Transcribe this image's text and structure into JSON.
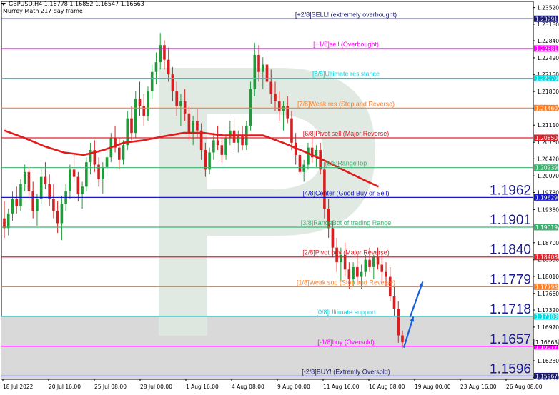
{
  "header": {
    "symbol_line": "GBPUSD,H4  1.16778 1.16852 1.16547 1.16663",
    "indicator_line": "Murrey Math 217 day frame"
  },
  "colors": {
    "background": "#ffffff",
    "bull_candle": "#1f9c3a",
    "bear_candle": "#d42020",
    "ma_line": "#e01b1b",
    "shaded_zone": "#d9d9d9",
    "arrow": "#1560e0",
    "axis_text": "#000000",
    "watermark": "#dde8df"
  },
  "chart_data": {
    "type": "candlestick",
    "title": "GBPUSD,H4",
    "ylim": [
      1.159,
      1.235
    ],
    "y_ticks": [
      "1.23520",
      "1.23180",
      "1.22840",
      "1.22490",
      "1.22150",
      "1.21800",
      "1.21450",
      "1.21110",
      "1.20760",
      "1.20420",
      "1.20070",
      "1.19730",
      "1.19380",
      "1.19040",
      "1.18700",
      "1.18350",
      "1.18010",
      "1.17660",
      "1.17320",
      "1.16970",
      "1.16630",
      "1.16280",
      "1.15940"
    ],
    "x_ticks": [
      "18 Jul 2022",
      "20 Jul 16:00",
      "25 Jul 08:00",
      "28 Jul 00:00",
      "1 Aug 16:00",
      "4 Aug 08:00",
      "9 Aug 00:00",
      "11 Aug 16:00",
      "16 Aug 08:00",
      "19 Aug 00:00",
      "23 Aug 16:00",
      "26 Aug 08:00"
    ],
    "murrey_levels": [
      {
        "label": "[+2/8]SELL! (extremely overbought)",
        "price": 1.23291,
        "tag": "1.23291",
        "color": "#1a1a6e"
      },
      {
        "label": "[+1/8]sell (Overbought)",
        "price": 1.22681,
        "tag": "1.22681",
        "color": "#ff00ff"
      },
      {
        "label": "[8/8]Ultimate resistance",
        "price": 1.2207,
        "tag": "1.22070",
        "color": "#00d8e0"
      },
      {
        "label": "[7/8]Weak res (Stop and Reverse)",
        "price": 1.2146,
        "tag": "1.21460",
        "color": "#ff7f27"
      },
      {
        "label": "[6/8]Pivot sell (Major Reverse)",
        "price": 1.2085,
        "tag": "1.20850",
        "color": "#e0202a"
      },
      {
        "label": "[5/8]RangeTop",
        "price": 1.20239,
        "tag": "1.20239",
        "color": "#3cb371"
      },
      {
        "label": "[4/8]Center (Good Buy or Sell)",
        "price": 1.19629,
        "tag": "1.19629",
        "color": "#1818c8"
      },
      {
        "label": "[3/8]RangeBot of trading Range",
        "price": 1.19019,
        "tag": "1.19019",
        "color": "#3cb371"
      },
      {
        "label": "[2/8]Pivot buy (Major Reverse)",
        "price": 1.18408,
        "tag": "1.18408",
        "color": "#e0202a"
      },
      {
        "label": "[1/8]Weak sup (Stop and Reverse)",
        "price": 1.17798,
        "tag": "1.17798",
        "color": "#ff7f27"
      },
      {
        "label": "[0/8]Ultimate support",
        "price": 1.17188,
        "tag": "1.17188",
        "color": "#00d8e0"
      },
      {
        "label": "[-1/8]buy (Oversold)",
        "price": 1.16577,
        "tag": "1.16577",
        "color": "#ff00ff"
      },
      {
        "label": "[-2/8]BUY! (Extremly Oversold)",
        "price": 1.15967,
        "tag": "1.15967",
        "color": "#1a1a6e"
      }
    ],
    "current_price_tag": "1.16663",
    "big_labels": [
      {
        "text": "1.1962",
        "price": 1.19629
      },
      {
        "text": "1.1901",
        "price": 1.19019
      },
      {
        "text": "1.1840",
        "price": 1.18408
      },
      {
        "text": "1.1779",
        "price": 1.17798
      },
      {
        "text": "1.1718",
        "price": 1.17188
      },
      {
        "text": "1.1657",
        "price": 1.16577
      },
      {
        "text": "1.1596",
        "price": 1.15967
      }
    ],
    "candles": [
      [
        1.192,
        1.1955,
        1.188,
        1.19
      ],
      [
        1.19,
        1.194,
        1.1885,
        1.193
      ],
      [
        1.193,
        1.1975,
        1.1915,
        1.196
      ],
      [
        1.196,
        1.1985,
        1.193,
        1.1945
      ],
      [
        1.1945,
        1.2,
        1.1935,
        1.199
      ],
      [
        1.199,
        1.203,
        1.1975,
        1.2015
      ],
      [
        1.2015,
        1.2025,
        1.196,
        1.1975
      ],
      [
        1.1975,
        1.1995,
        1.192,
        1.1935
      ],
      [
        1.1935,
        1.197,
        1.1905,
        1.196
      ],
      [
        1.196,
        1.202,
        1.195,
        1.2005
      ],
      [
        1.2005,
        1.2035,
        1.198,
        1.199
      ],
      [
        1.199,
        1.201,
        1.1945,
        1.196
      ],
      [
        1.196,
        1.199,
        1.192,
        1.1935
      ],
      [
        1.1935,
        1.1955,
        1.189,
        1.191
      ],
      [
        1.191,
        1.1965,
        1.1875,
        1.195
      ],
      [
        1.195,
        1.199,
        1.1935,
        1.1975
      ],
      [
        1.1975,
        1.203,
        1.196,
        1.202
      ],
      [
        1.202,
        1.205,
        1.1995,
        1.2005
      ],
      [
        1.2005,
        1.2015,
        1.1955,
        1.197
      ],
      [
        1.197,
        1.1995,
        1.194,
        1.1985
      ],
      [
        1.1985,
        1.2045,
        1.1975,
        1.2035
      ],
      [
        1.2035,
        1.2075,
        1.201,
        1.206
      ],
      [
        1.206,
        1.208,
        1.2015,
        1.203
      ],
      [
        1.203,
        1.2045,
        1.1985,
        1.2
      ],
      [
        1.2,
        1.2035,
        1.197,
        1.2025
      ],
      [
        1.2025,
        1.206,
        1.2005,
        1.2045
      ],
      [
        1.2045,
        1.2095,
        1.2035,
        1.2085
      ],
      [
        1.2085,
        1.211,
        1.2055,
        1.2065
      ],
      [
        1.2065,
        1.2085,
        1.202,
        1.204
      ],
      [
        1.204,
        1.208,
        1.203,
        1.207
      ],
      [
        1.207,
        1.214,
        1.206,
        1.2125
      ],
      [
        1.2125,
        1.215,
        1.208,
        1.2095
      ],
      [
        1.2095,
        1.218,
        1.2085,
        1.2165
      ],
      [
        1.2165,
        1.22,
        1.213,
        1.215
      ],
      [
        1.215,
        1.2175,
        1.211,
        1.213
      ],
      [
        1.213,
        1.219,
        1.212,
        1.218
      ],
      [
        1.218,
        1.2235,
        1.2165,
        1.222
      ],
      [
        1.222,
        1.226,
        1.2195,
        1.224
      ],
      [
        1.224,
        1.23,
        1.2225,
        1.2275
      ],
      [
        1.2275,
        1.2285,
        1.2225,
        1.2245
      ],
      [
        1.2245,
        1.227,
        1.22,
        1.2215
      ],
      [
        1.2215,
        1.223,
        1.216,
        1.218
      ],
      [
        1.218,
        1.22,
        1.213,
        1.215
      ],
      [
        1.215,
        1.2175,
        1.211,
        1.216
      ],
      [
        1.216,
        1.2185,
        1.212,
        1.2135
      ],
      [
        1.2135,
        1.215,
        1.208,
        1.2095
      ],
      [
        1.2095,
        1.213,
        1.207,
        1.212
      ],
      [
        1.212,
        1.2145,
        1.2085,
        1.21
      ],
      [
        1.21,
        1.2115,
        1.204,
        1.206
      ],
      [
        1.206,
        1.2075,
        1.2005,
        1.202
      ],
      [
        1.202,
        1.2065,
        1.201,
        1.2055
      ],
      [
        1.2055,
        1.2095,
        1.204,
        1.208
      ],
      [
        1.208,
        1.211,
        1.206,
        1.207
      ],
      [
        1.207,
        1.2085,
        1.2035,
        1.205
      ],
      [
        1.205,
        1.209,
        1.204,
        1.2085
      ],
      [
        1.2085,
        1.212,
        1.207,
        1.21
      ],
      [
        1.21,
        1.2125,
        1.206,
        1.2075
      ],
      [
        1.2075,
        1.21,
        1.2055,
        1.209
      ],
      [
        1.209,
        1.211,
        1.206,
        1.207
      ],
      [
        1.207,
        1.212,
        1.206,
        1.211
      ],
      [
        1.211,
        1.22,
        1.21,
        1.2185
      ],
      [
        1.2185,
        1.228,
        1.217,
        1.2255
      ],
      [
        1.2255,
        1.2275,
        1.22,
        1.222
      ],
      [
        1.222,
        1.225,
        1.2185,
        1.2235
      ],
      [
        1.2235,
        1.2255,
        1.219,
        1.22
      ],
      [
        1.22,
        1.2225,
        1.2155,
        1.2175
      ],
      [
        1.2175,
        1.22,
        1.214,
        1.216
      ],
      [
        1.216,
        1.218,
        1.212,
        1.214
      ],
      [
        1.214,
        1.216,
        1.21,
        1.215
      ],
      [
        1.215,
        1.217,
        1.2115,
        1.2125
      ],
      [
        1.2125,
        1.214,
        1.206,
        1.2075
      ],
      [
        1.2075,
        1.2095,
        1.203,
        1.205
      ],
      [
        1.205,
        1.207,
        1.2005,
        1.2015
      ],
      [
        1.2015,
        1.204,
        1.1995,
        1.203
      ],
      [
        1.203,
        1.2075,
        1.202,
        1.2065
      ],
      [
        1.2065,
        1.209,
        1.2035,
        1.2045
      ],
      [
        1.2045,
        1.207,
        1.2025,
        1.206
      ],
      [
        1.206,
        1.2075,
        1.201,
        1.202
      ],
      [
        1.202,
        1.2035,
        1.192,
        1.194
      ],
      [
        1.194,
        1.196,
        1.188,
        1.19
      ],
      [
        1.19,
        1.1915,
        1.184,
        1.186
      ],
      [
        1.186,
        1.188,
        1.181,
        1.183
      ],
      [
        1.183,
        1.186,
        1.179,
        1.1845
      ],
      [
        1.1845,
        1.187,
        1.18,
        1.1815
      ],
      [
        1.1815,
        1.183,
        1.1775,
        1.1795
      ],
      [
        1.1795,
        1.183,
        1.178,
        1.182
      ],
      [
        1.182,
        1.185,
        1.179,
        1.18
      ],
      [
        1.18,
        1.1825,
        1.1775,
        1.181
      ],
      [
        1.181,
        1.1845,
        1.18,
        1.1835
      ],
      [
        1.1835,
        1.186,
        1.181,
        1.182
      ],
      [
        1.182,
        1.1845,
        1.1795,
        1.184
      ],
      [
        1.184,
        1.186,
        1.1815,
        1.1825
      ],
      [
        1.1825,
        1.185,
        1.179,
        1.181
      ],
      [
        1.181,
        1.183,
        1.178,
        1.18
      ],
      [
        1.18,
        1.182,
        1.175,
        1.176
      ],
      [
        1.176,
        1.178,
        1.172,
        1.1735
      ],
      [
        1.1735,
        1.175,
        1.1665,
        1.168
      ],
      [
        1.168,
        1.169,
        1.1655,
        1.1666
      ]
    ],
    "ma_points": [
      [
        0,
        1.21
      ],
      [
        0.05,
        1.2085
      ],
      [
        0.1,
        1.2068
      ],
      [
        0.15,
        1.2055
      ],
      [
        0.2,
        1.205
      ],
      [
        0.25,
        1.206
      ],
      [
        0.3,
        1.2075
      ],
      [
        0.35,
        1.208
      ],
      [
        0.4,
        1.2088
      ],
      [
        0.45,
        1.2095
      ],
      [
        0.5,
        1.2095
      ],
      [
        0.55,
        1.209
      ],
      [
        0.6,
        1.209
      ],
      [
        0.65,
        1.209
      ],
      [
        0.7,
        1.2075
      ],
      [
        0.75,
        1.2058
      ],
      [
        0.8,
        1.204
      ],
      [
        0.85,
        1.202
      ],
      [
        0.9,
        1.2
      ],
      [
        0.94,
        1.1985
      ]
    ],
    "ma_end_fraction": 0.94,
    "arrows": [
      {
        "from": [
          1.1655,
          0.0
        ],
        "to": [
          1.1718,
          0.06
        ]
      },
      {
        "from": [
          1.1718,
          0.04
        ],
        "to": [
          1.179,
          0.12
        ]
      }
    ]
  }
}
